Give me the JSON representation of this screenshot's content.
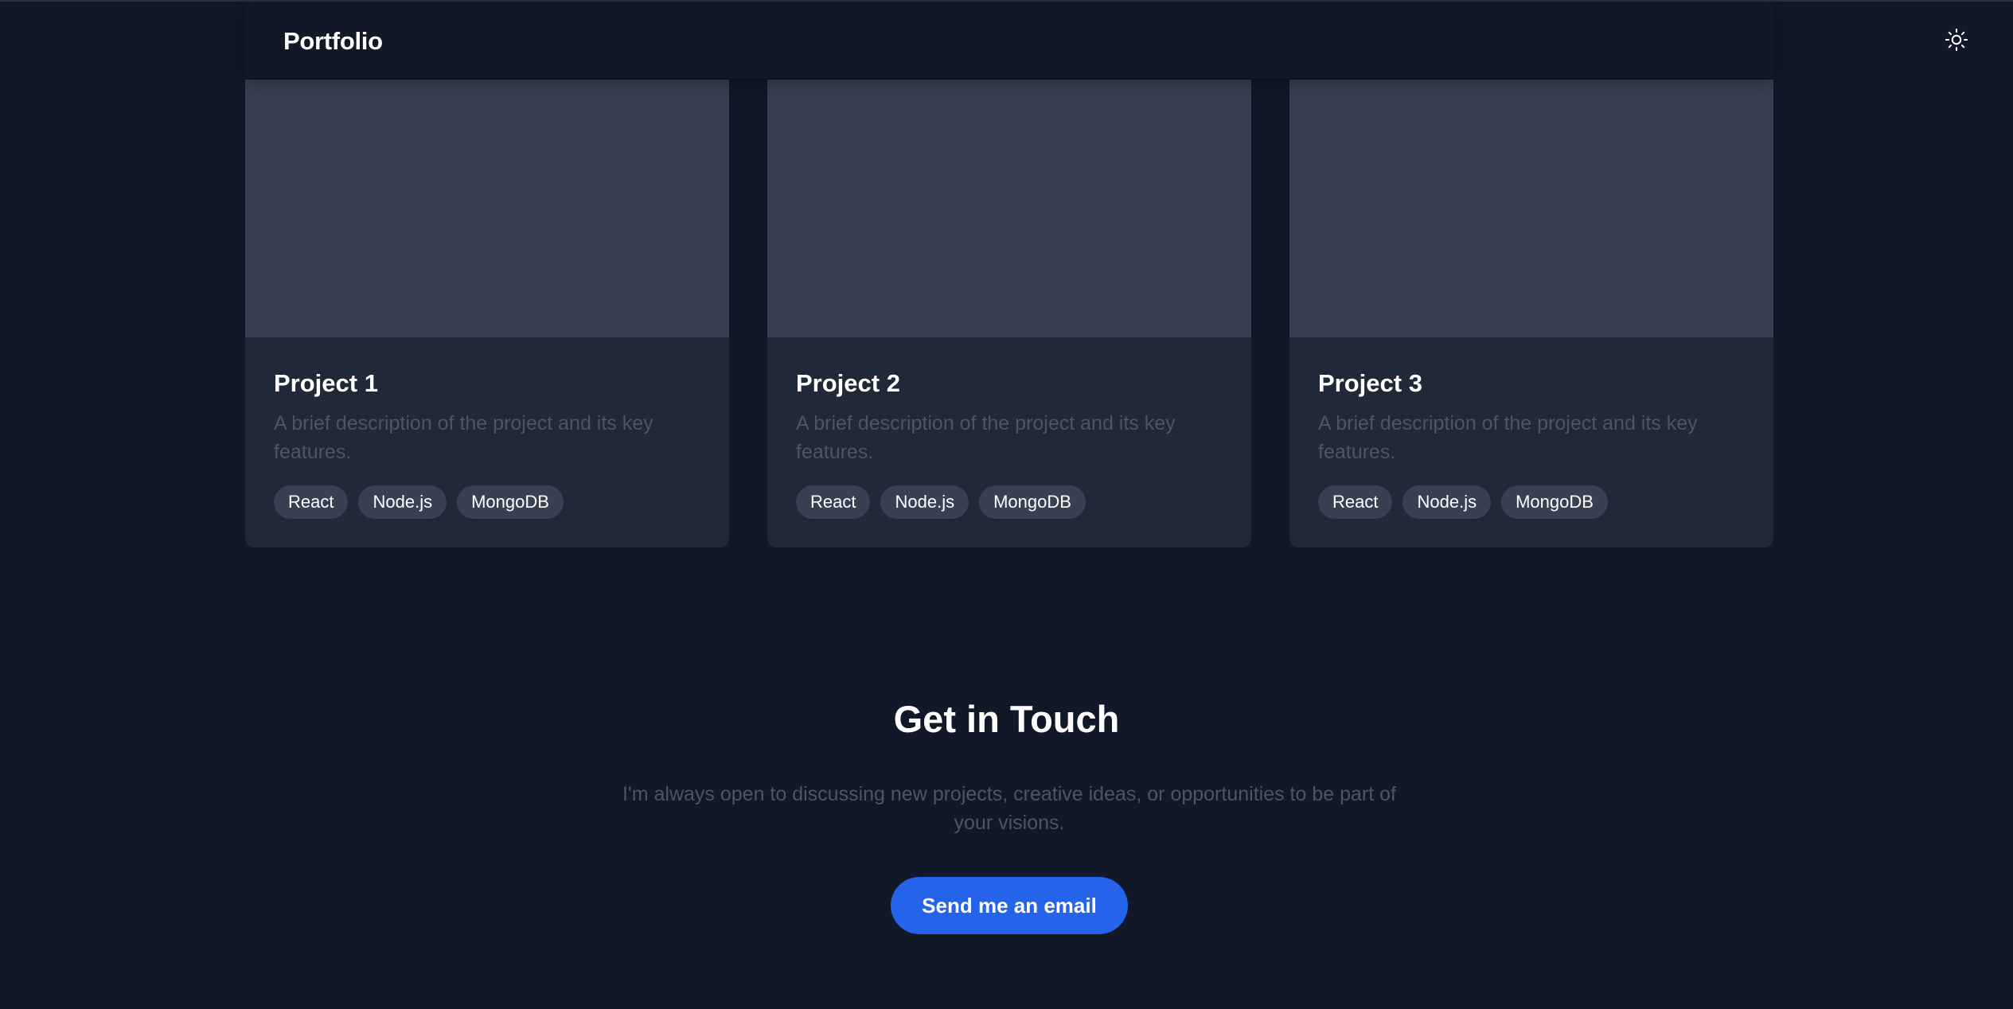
{
  "header": {
    "brand": "Portfolio",
    "theme_toggle_icon": "sun-icon"
  },
  "projects": [
    {
      "title": "Project 1",
      "description": "A brief description of the project and its key features.",
      "tags": [
        "React",
        "Node.js",
        "MongoDB"
      ]
    },
    {
      "title": "Project 2",
      "description": "A brief description of the project and its key features.",
      "tags": [
        "React",
        "Node.js",
        "MongoDB"
      ]
    },
    {
      "title": "Project 3",
      "description": "A brief description of the project and its key features.",
      "tags": [
        "React",
        "Node.js",
        "MongoDB"
      ]
    }
  ],
  "contact": {
    "title": "Get in Touch",
    "text": "I'm always open to discussing new projects, creative ideas, or opportunities to be part of your visions.",
    "button_label": "Send me an email"
  },
  "colors": {
    "background": "#111827",
    "card": "#1f2937",
    "card_image": "#374151",
    "accent": "#2563eb",
    "muted_text": "#4b5563"
  }
}
